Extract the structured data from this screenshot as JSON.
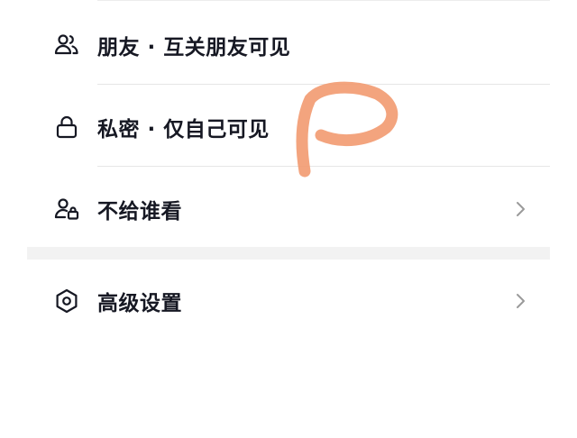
{
  "visibility_options": [
    {
      "id": "friends",
      "icon": "friends-icon",
      "label": "朋友 · 互关朋友可见",
      "has_chevron": false
    },
    {
      "id": "private",
      "icon": "lock-icon",
      "label": "私密 · 仅自己可见",
      "has_chevron": false
    },
    {
      "id": "exclude",
      "icon": "user-lock-icon",
      "label": "不给谁看",
      "has_chevron": true
    }
  ],
  "advanced": {
    "icon": "hexagon-settings-icon",
    "label": "高级设置",
    "has_chevron": true
  },
  "colors": {
    "text": "#161823",
    "icon": "#161823",
    "chevron": "#9a9a9a",
    "divider": "#e6e6e6",
    "section_gap": "#f2f2f2",
    "scribble": "#f29a70"
  }
}
